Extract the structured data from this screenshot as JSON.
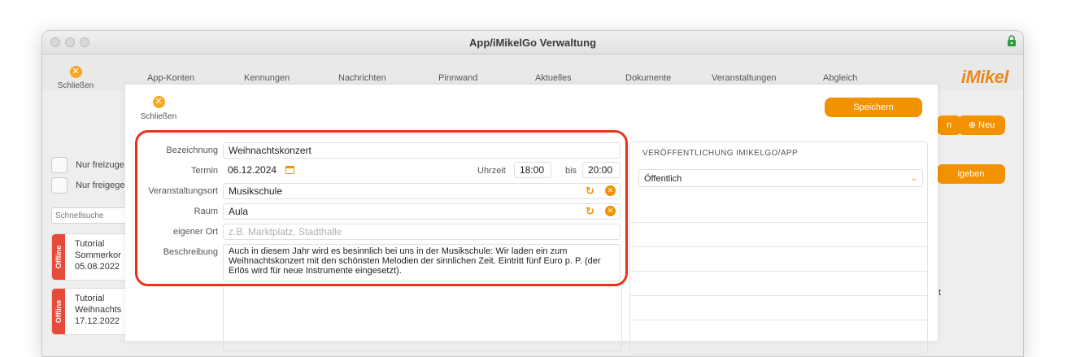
{
  "window": {
    "title": "App/iMikelGo Verwaltung"
  },
  "toolbar": {
    "close_label": "Schließen",
    "tabs": [
      "App-Konten",
      "Kennungen",
      "Nachrichten",
      "Pinnwand",
      "Aktuelles",
      "Dokumente",
      "Veranstaltungen",
      "Abgleich"
    ],
    "logo": "iMikel"
  },
  "background": {
    "btn_partial": "n",
    "btn_new": "Neu",
    "btn_release": "igeben",
    "filters": [
      "Nur freizuge",
      "Nur freigege"
    ],
    "quick_search": "Schnellsuche",
    "list": [
      {
        "status": "Offline",
        "lines": [
          "Tutorial",
          "Sommerkor",
          "05.08.2022"
        ]
      },
      {
        "status": "Offline",
        "lines": [
          "Tutorial",
          "Weihnachts",
          "17.12.2022"
        ]
      }
    ],
    "side_char": "t"
  },
  "dialog": {
    "close_label": "Schließen",
    "save_label": "Speichern",
    "labels": {
      "name": "Bezeichnung",
      "date": "Termin",
      "time": "Uhrzeit",
      "to": "bis",
      "venue": "Veranstaltungsort",
      "room": "Raum",
      "own_place": "eigener Ort",
      "description": "Beschreibung"
    },
    "values": {
      "name": "Weihnachtskonzert",
      "date": "06.12.2024",
      "time_from": "18:00",
      "time_to": "20:00",
      "venue": "Musikschule",
      "room": "Aula",
      "own_place_placeholder": "z.B. Marktplatz, Stadthalle",
      "description": "Auch in diesem Jahr wird es besinnlich bei uns in der Musikschule: Wir laden ein zum Weihnachtskonzert mit den schönsten Melodien der sinnlichen Zeit. Eintritt fünf Euro p. P. (der Erlös wird für neue Instrumente eingesetzt)."
    },
    "publication": {
      "heading": "VERÖFFENTLICHUNG IMIKELGO/APP",
      "selected": "Öffentlich"
    }
  },
  "colors": {
    "accent": "#f39200",
    "highlight": "#e8321e",
    "offline": "#e84a3a"
  }
}
